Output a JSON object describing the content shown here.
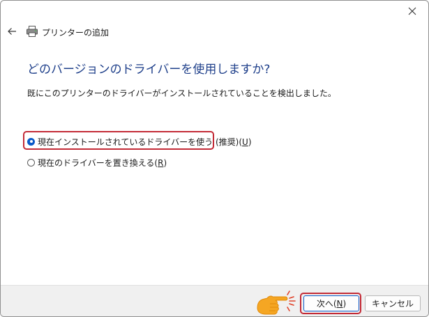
{
  "window": {
    "close_icon": "close-icon"
  },
  "header": {
    "back_icon": "arrow-left-icon",
    "printer_icon": "printer-icon",
    "title": "プリンターの追加"
  },
  "main": {
    "heading": "どのバージョンのドライバーを使用しますか?",
    "description": "既にこのプリンターのドライバーがインストールされていることを検出しました。",
    "options": [
      {
        "label": "現在インストールされているドライバーを使う (推奨)(",
        "access_key": "U",
        "suffix": ")",
        "checked": true
      },
      {
        "label": "現在のドライバーを置き換える(",
        "access_key": "R",
        "suffix": ")",
        "checked": false
      }
    ]
  },
  "footer": {
    "next_label": "次へ(",
    "next_key": "N",
    "next_suffix": ")",
    "cancel_label": "キャンセル"
  },
  "colors": {
    "heading": "#1e3f8a",
    "accent": "#0a5ac8",
    "highlight": "#c32a36",
    "pointer": "#f5a623"
  }
}
